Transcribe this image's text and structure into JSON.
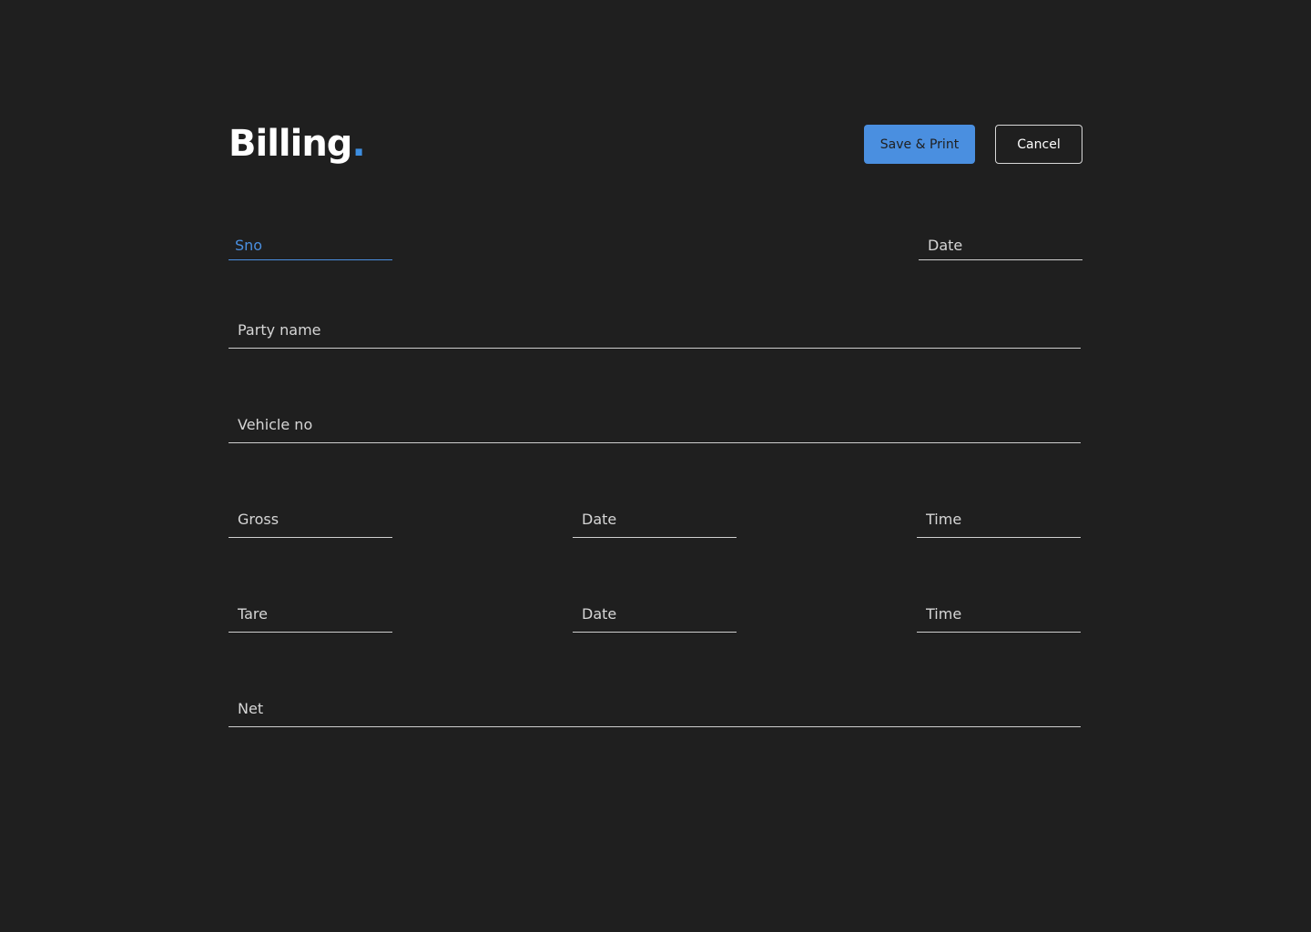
{
  "header": {
    "title": "Billing",
    "title_dot": ".",
    "save_label": "Save & Print",
    "cancel_label": "Cancel"
  },
  "form": {
    "sno": {
      "placeholder": "Sno",
      "value": ""
    },
    "date": {
      "placeholder": "Date",
      "value": ""
    },
    "party_name": {
      "placeholder": "Party name",
      "value": ""
    },
    "vehicle_no": {
      "placeholder": "Vehicle no",
      "value": ""
    },
    "gross": {
      "placeholder": "Gross",
      "value": ""
    },
    "gross_date": {
      "placeholder": "Date",
      "value": ""
    },
    "gross_time": {
      "placeholder": "Time",
      "value": ""
    },
    "tare": {
      "placeholder": "Tare",
      "value": ""
    },
    "tare_date": {
      "placeholder": "Date",
      "value": ""
    },
    "tare_time": {
      "placeholder": "Time",
      "value": ""
    },
    "net": {
      "placeholder": "Net",
      "value": ""
    }
  },
  "colors": {
    "background": "#1f1f1f",
    "accent": "#4a8fe0",
    "text": "#ffffff",
    "underline": "#cfcfcf"
  }
}
